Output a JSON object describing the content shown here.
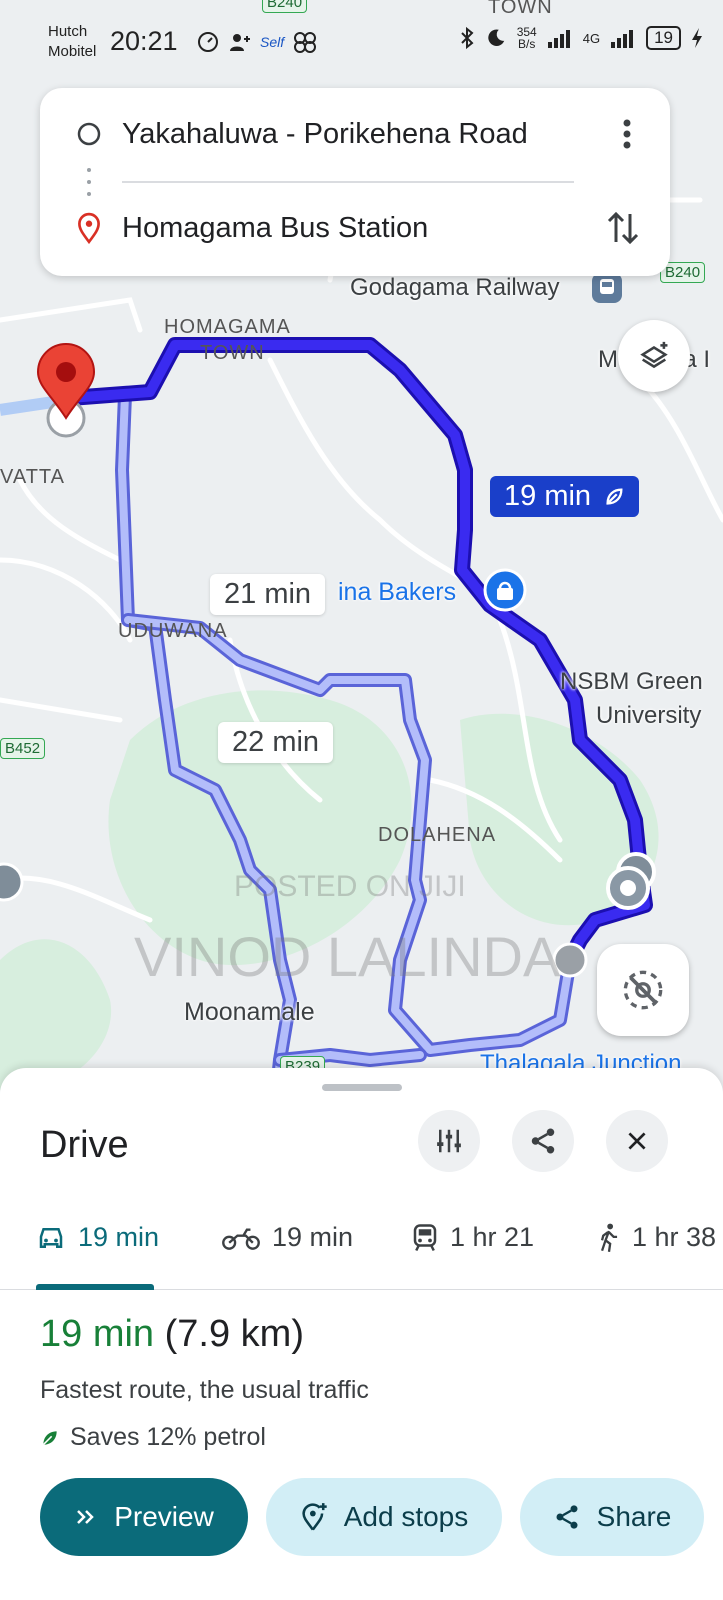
{
  "status_bar": {
    "carrier_line1": "Hutch",
    "carrier_line2": "Mobitel",
    "time": "20:21",
    "self_label": "Self",
    "net_speed_value": "354",
    "net_speed_unit": "B/s",
    "network": "4G",
    "battery": "19"
  },
  "route_card": {
    "origin": "Yakahaluwa - Porikehena Road",
    "destination": "Homagama Bus Station"
  },
  "map": {
    "labels": {
      "town_top": "TOWN",
      "homagama_town_1": "HOMAGAMA",
      "homagama_town_2": "TOWN",
      "godagama": "Godagama Railway",
      "watta": "VATTA",
      "uduwana": "UDUWANA",
      "bakers": "ina Bakers",
      "nsbm_1": "NSBM Green",
      "nsbm_2": "University",
      "dolahena": "DOLAHENA",
      "moonamale": "Moonamale",
      "thalagala": "Thalagala Junction",
      "mda": "M",
      "mda2": "da I"
    },
    "road_shields": [
      "B240",
      "B240",
      "B452",
      "B239"
    ],
    "route_times": {
      "active": "19 min",
      "alt1": "21 min",
      "alt2": "22 min"
    },
    "watermark_line1": "POSTED ON JIJI",
    "watermark_line2": "VINOD LALINDA"
  },
  "sheet": {
    "title": "Drive",
    "modes": [
      {
        "icon": "car-icon",
        "label": "19 min"
      },
      {
        "icon": "motorbike-icon",
        "label": "19 min"
      },
      {
        "icon": "transit-icon",
        "label": "1 hr 21"
      },
      {
        "icon": "walk-icon",
        "label": "1 hr 38"
      }
    ],
    "summary_time": "19 min",
    "summary_distance": "(7.9 km)",
    "route_description": "Fastest route, the usual traffic",
    "eco_text": "Saves 12% petrol",
    "buttons": {
      "preview": "Preview",
      "add_stops": "Add stops",
      "share": "Share"
    }
  },
  "colors": {
    "active_route": "#2a1fd6",
    "alt_route": "#9aa8f7",
    "accent_teal": "#0b6b7a",
    "eco_green": "#188038"
  }
}
